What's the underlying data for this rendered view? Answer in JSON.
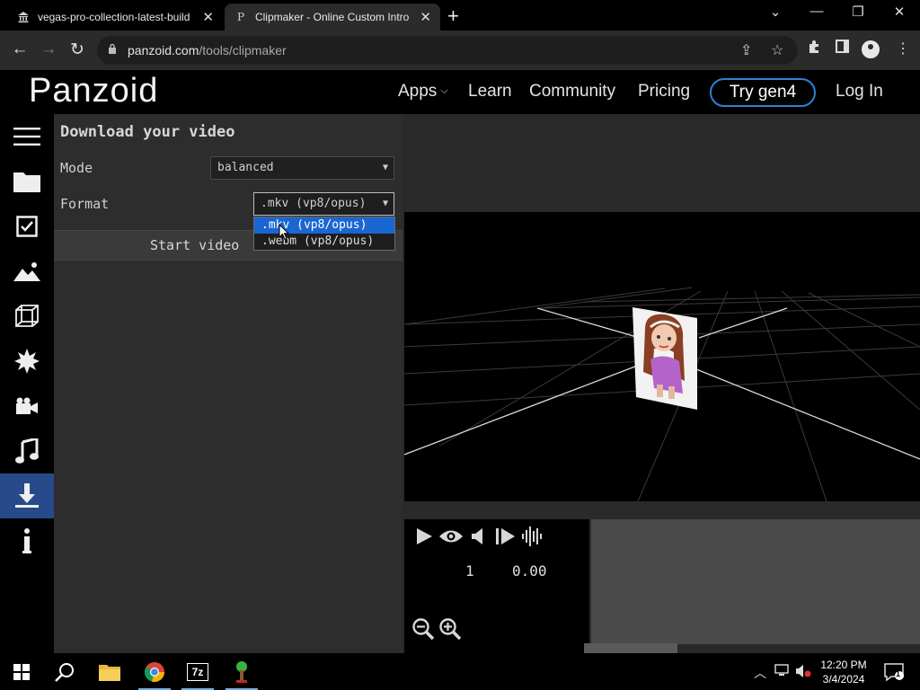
{
  "browser": {
    "tabs": [
      {
        "title": "vegas-pro-collection-latest-build",
        "icon": "bank-icon",
        "active": false
      },
      {
        "title": "Clipmaker - Online Custom Intro",
        "icon": "panzoid-p-icon",
        "active": true
      }
    ],
    "url_domain": "panzoid.com",
    "url_path": "/tools/clipmaker",
    "new_tab_symbol": "+",
    "close_symbol": "✕"
  },
  "site": {
    "logo": "Panzoid",
    "nav": {
      "apps": "Apps",
      "learn": "Learn",
      "community": "Community",
      "pricing": "Pricing",
      "try_gen4": "Try gen4",
      "login": "Log In"
    }
  },
  "sidebar_icons": [
    "menu-icon",
    "folder-icon",
    "checkbox-icon",
    "image-icon",
    "cube-icon",
    "effects-icon",
    "camera-icon",
    "music-icon",
    "download-icon",
    "info-icon"
  ],
  "panel": {
    "title": "Download your video",
    "mode_label": "Mode",
    "mode_value": "balanced",
    "format_label": "Format",
    "format_value": ".mkv (vp8/opus)",
    "format_options": [
      ".mkv (vp8/opus)",
      ".webm (vp8/opus)"
    ],
    "start_button": "Start video"
  },
  "player": {
    "frame": "1",
    "time": "0.00"
  },
  "taskbar": {
    "apps": [
      "windows-start-icon",
      "search-icon",
      "file-explorer-icon",
      "chrome-icon",
      "7zip-icon",
      "tree-app-icon"
    ],
    "time": "12:20 PM",
    "date": "3/4/2024",
    "notification_count": "1",
    "zip_label": "7z"
  },
  "colors": {
    "accent_blue": "#2f80d6",
    "active_sidebar": "#264a8a",
    "dropdown_highlight": "#1a66d2"
  }
}
